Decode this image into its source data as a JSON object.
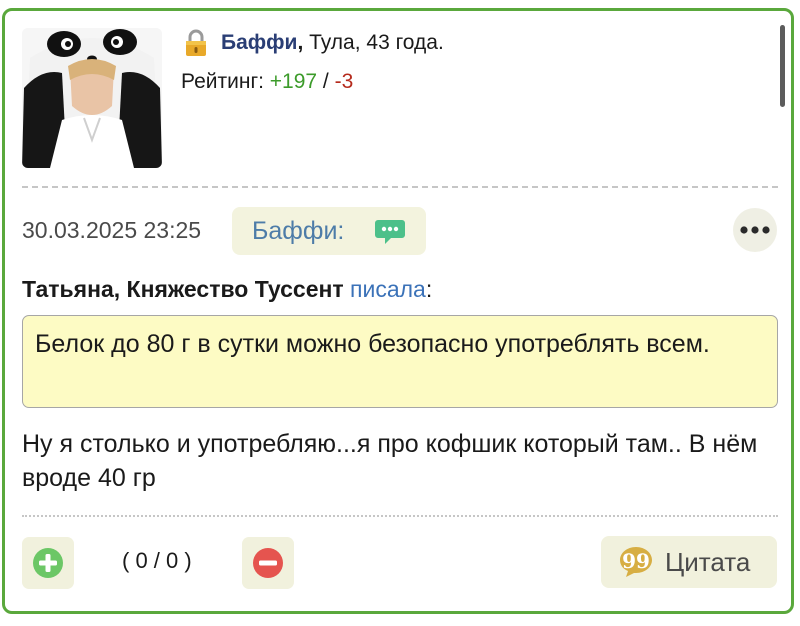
{
  "user": {
    "name": "Баффи",
    "name_suffix": ",",
    "location_age": " Тула, 43 года.",
    "rating_label": "Рейтинг: ",
    "rating_positive": "+197",
    "rating_separator": " / ",
    "rating_negative": "-3"
  },
  "post": {
    "date": "30.03.2025 23:25",
    "author_chip": "Баффи:",
    "quote_author": "Татьяна, Княжество Туссент",
    "quote_wrote": "писала",
    "quote_colon": ":",
    "quote_text": "Белок до 80 г в сутки можно безопасно употреблять всем.",
    "message": "Ну я столько и употребляю...я про кофшик который там.. В нём вроде 40 гр"
  },
  "votes": {
    "count": "( 0 / 0 )"
  },
  "actions": {
    "quote_label": "Цитата"
  },
  "colors": {
    "card_border": "#5aa83c",
    "rating_positive": "#3c9b2a",
    "rating_negative": "#b52a1c",
    "quote_bg": "#fdfbc4",
    "button_bg": "#f1f1dd"
  },
  "icons": [
    "lock-icon",
    "chat-bubble-icon",
    "more-dots-icon",
    "plus-icon",
    "minus-icon",
    "quote-icon"
  ]
}
